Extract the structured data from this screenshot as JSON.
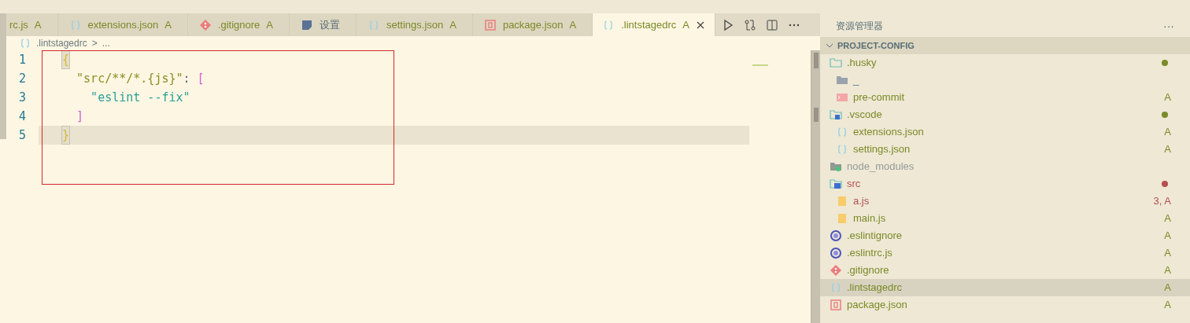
{
  "tabs": [
    {
      "label": "rc.js",
      "badge": "A",
      "kind": "plain",
      "selected": false
    },
    {
      "label": "extensions.json",
      "badge": "A",
      "kind": "json",
      "selected": false
    },
    {
      "label": ".gitignore",
      "badge": "A",
      "kind": "git",
      "selected": false
    },
    {
      "label": "设置",
      "kind": "settings",
      "selected": false
    },
    {
      "label": "settings.json",
      "badge": "A",
      "kind": "json",
      "selected": false
    },
    {
      "label": "package.json",
      "badge": "A",
      "kind": "npm",
      "selected": false
    },
    {
      "label": ".lintstagedrc",
      "badge": "A",
      "kind": "json",
      "selected": true
    }
  ],
  "breadcrumb": {
    "file": ".lintstagedrc",
    "separator": ">",
    "rest": "..."
  },
  "code": [
    {
      "number": "1",
      "current": false,
      "tokens": [
        {
          "kind": "brace-match",
          "text": "{"
        }
      ]
    },
    {
      "number": "2",
      "current": false,
      "tokens": [
        {
          "kind": "key",
          "text": "  \"src/**/*.{js}\""
        },
        {
          "kind": "punct",
          "text": ": "
        },
        {
          "kind": "bracket",
          "text": "["
        }
      ]
    },
    {
      "number": "3",
      "current": false,
      "tokens": [
        {
          "kind": "string",
          "text": "    \"eslint --fix\""
        }
      ]
    },
    {
      "number": "4",
      "current": false,
      "tokens": [
        {
          "kind": "bracket",
          "text": "  ]"
        }
      ]
    },
    {
      "number": "5",
      "current": true,
      "tokens": [
        {
          "kind": "brace-match",
          "text": "}"
        }
      ]
    }
  ],
  "explorer": {
    "title": "资源管理器",
    "more": "···",
    "root": {
      "label": "PROJECT-CONFIG",
      "expanded": true
    },
    "items": [
      {
        "name": ".husky",
        "kind": "folder",
        "color": "#7b8a27",
        "dot": true,
        "selected": false,
        "children": [
          {
            "name": "_",
            "kind": "folder-gray",
            "selected": false
          },
          {
            "name": "pre-commit",
            "kind": "shell",
            "color": "#7b8a27",
            "badge": "A",
            "selected": false
          }
        ]
      },
      {
        "name": ".vscode",
        "kind": "folder-vscode",
        "color": "#7b8a27",
        "dot": true,
        "selected": false,
        "children": [
          {
            "name": "extensions.json",
            "kind": "json",
            "color": "#7b8a27",
            "badge": "A",
            "selected": false
          },
          {
            "name": "settings.json",
            "kind": "json",
            "color": "#7b8a27",
            "badge": "A",
            "selected": false
          }
        ]
      },
      {
        "name": "node_modules",
        "kind": "folder-node",
        "color": "#959c97",
        "selected": false
      },
      {
        "name": "src",
        "kind": "folder-src",
        "color": "#b4504f",
        "dot": true,
        "selected": false,
        "children": [
          {
            "name": "a.js",
            "kind": "js",
            "color": "#b4504f",
            "badge": "3, A",
            "selected": false
          },
          {
            "name": "main.js",
            "kind": "js",
            "color": "#7b8a27",
            "badge": "A",
            "selected": false
          }
        ]
      },
      {
        "name": ".eslintignore",
        "kind": "eslint",
        "color": "#7b8a27",
        "badge": "A",
        "selected": false
      },
      {
        "name": ".eslintrc.js",
        "kind": "eslint",
        "color": "#7b8a27",
        "badge": "A",
        "selected": false
      },
      {
        "name": ".gitignore",
        "kind": "git",
        "color": "#7b8a27",
        "badge": "A",
        "selected": false
      },
      {
        "name": ".lintstagedrc",
        "kind": "json",
        "color": "#7b8a27",
        "badge": "A",
        "selected": true
      },
      {
        "name": "package.json",
        "kind": "npm",
        "color": "#7b8a27",
        "badge": "A",
        "selected": false
      }
    ]
  }
}
